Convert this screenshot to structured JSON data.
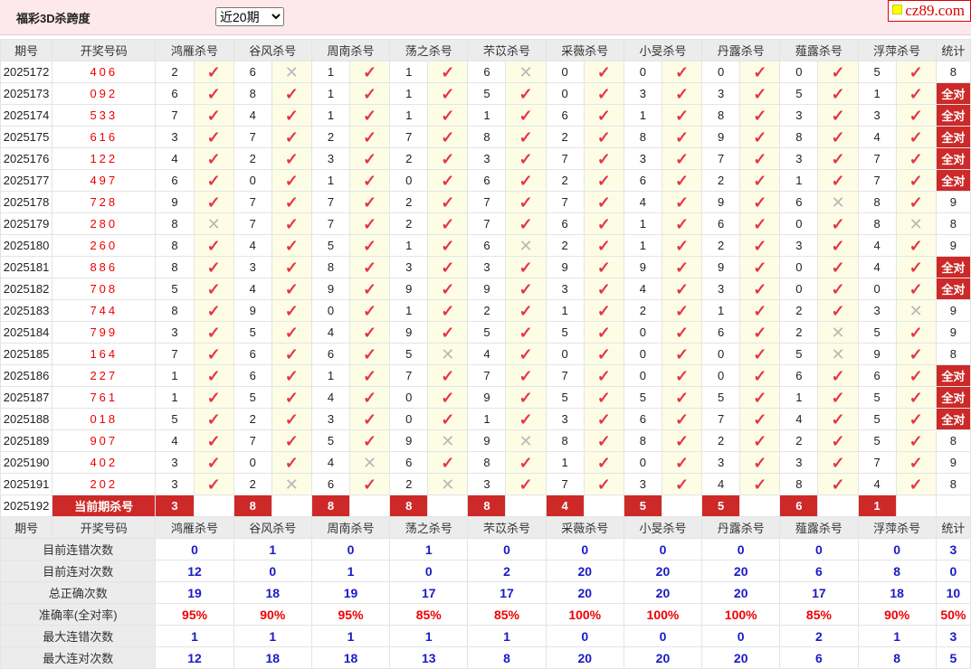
{
  "title": "福彩3D杀跨度",
  "period_select": {
    "selected": "近20期"
  },
  "logo": "cz89.com",
  "icons": {
    "ok": "✓",
    "no": "✕"
  },
  "headers": [
    "期号",
    "开奖号码",
    "鸿雁杀号",
    "谷风杀号",
    "周南杀号",
    "荡之杀号",
    "芣苡杀号",
    "采薇杀号",
    "小旻杀号",
    "丹露杀号",
    "薤露杀号",
    "浮萍杀号",
    "统计"
  ],
  "rows": [
    {
      "p": "2025172",
      "d": "406",
      "k": [
        [
          2,
          1
        ],
        [
          6,
          0
        ],
        [
          1,
          1
        ],
        [
          1,
          1
        ],
        [
          6,
          0
        ],
        [
          0,
          1
        ],
        [
          0,
          1
        ],
        [
          0,
          1
        ],
        [
          0,
          1
        ],
        [
          5,
          1
        ]
      ],
      "s": "8"
    },
    {
      "p": "2025173",
      "d": "092",
      "k": [
        [
          6,
          1
        ],
        [
          8,
          1
        ],
        [
          1,
          1
        ],
        [
          1,
          1
        ],
        [
          5,
          1
        ],
        [
          0,
          1
        ],
        [
          3,
          1
        ],
        [
          3,
          1
        ],
        [
          5,
          1
        ],
        [
          1,
          1
        ]
      ],
      "s": "全对"
    },
    {
      "p": "2025174",
      "d": "533",
      "k": [
        [
          7,
          1
        ],
        [
          4,
          1
        ],
        [
          1,
          1
        ],
        [
          1,
          1
        ],
        [
          1,
          1
        ],
        [
          6,
          1
        ],
        [
          1,
          1
        ],
        [
          8,
          1
        ],
        [
          3,
          1
        ],
        [
          3,
          1
        ]
      ],
      "s": "全对"
    },
    {
      "p": "2025175",
      "d": "616",
      "k": [
        [
          3,
          1
        ],
        [
          7,
          1
        ],
        [
          2,
          1
        ],
        [
          7,
          1
        ],
        [
          8,
          1
        ],
        [
          2,
          1
        ],
        [
          8,
          1
        ],
        [
          9,
          1
        ],
        [
          8,
          1
        ],
        [
          4,
          1
        ]
      ],
      "s": "全对"
    },
    {
      "p": "2025176",
      "d": "122",
      "k": [
        [
          4,
          1
        ],
        [
          2,
          1
        ],
        [
          3,
          1
        ],
        [
          2,
          1
        ],
        [
          3,
          1
        ],
        [
          7,
          1
        ],
        [
          3,
          1
        ],
        [
          7,
          1
        ],
        [
          3,
          1
        ],
        [
          7,
          1
        ]
      ],
      "s": "全对"
    },
    {
      "p": "2025177",
      "d": "497",
      "k": [
        [
          6,
          1
        ],
        [
          0,
          1
        ],
        [
          1,
          1
        ],
        [
          0,
          1
        ],
        [
          6,
          1
        ],
        [
          2,
          1
        ],
        [
          6,
          1
        ],
        [
          2,
          1
        ],
        [
          1,
          1
        ],
        [
          7,
          1
        ]
      ],
      "s": "全对"
    },
    {
      "p": "2025178",
      "d": "728",
      "k": [
        [
          9,
          1
        ],
        [
          7,
          1
        ],
        [
          7,
          1
        ],
        [
          2,
          1
        ],
        [
          7,
          1
        ],
        [
          7,
          1
        ],
        [
          4,
          1
        ],
        [
          9,
          1
        ],
        [
          6,
          0
        ],
        [
          8,
          1
        ]
      ],
      "s": "9"
    },
    {
      "p": "2025179",
      "d": "280",
      "k": [
        [
          8,
          0
        ],
        [
          7,
          1
        ],
        [
          7,
          1
        ],
        [
          2,
          1
        ],
        [
          7,
          1
        ],
        [
          6,
          1
        ],
        [
          1,
          1
        ],
        [
          6,
          1
        ],
        [
          0,
          1
        ],
        [
          8,
          0
        ]
      ],
      "s": "8"
    },
    {
      "p": "2025180",
      "d": "260",
      "k": [
        [
          8,
          1
        ],
        [
          4,
          1
        ],
        [
          5,
          1
        ],
        [
          1,
          1
        ],
        [
          6,
          0
        ],
        [
          2,
          1
        ],
        [
          1,
          1
        ],
        [
          2,
          1
        ],
        [
          3,
          1
        ],
        [
          4,
          1
        ]
      ],
      "s": "9"
    },
    {
      "p": "2025181",
      "d": "886",
      "k": [
        [
          8,
          1
        ],
        [
          3,
          1
        ],
        [
          8,
          1
        ],
        [
          3,
          1
        ],
        [
          3,
          1
        ],
        [
          9,
          1
        ],
        [
          9,
          1
        ],
        [
          9,
          1
        ],
        [
          0,
          1
        ],
        [
          4,
          1
        ]
      ],
      "s": "全对"
    },
    {
      "p": "2025182",
      "d": "708",
      "k": [
        [
          5,
          1
        ],
        [
          4,
          1
        ],
        [
          9,
          1
        ],
        [
          9,
          1
        ],
        [
          9,
          1
        ],
        [
          3,
          1
        ],
        [
          4,
          1
        ],
        [
          3,
          1
        ],
        [
          0,
          1
        ],
        [
          0,
          1
        ]
      ],
      "s": "全对"
    },
    {
      "p": "2025183",
      "d": "744",
      "k": [
        [
          8,
          1
        ],
        [
          9,
          1
        ],
        [
          0,
          1
        ],
        [
          1,
          1
        ],
        [
          2,
          1
        ],
        [
          1,
          1
        ],
        [
          2,
          1
        ],
        [
          1,
          1
        ],
        [
          2,
          1
        ],
        [
          3,
          0
        ]
      ],
      "s": "9"
    },
    {
      "p": "2025184",
      "d": "799",
      "k": [
        [
          3,
          1
        ],
        [
          5,
          1
        ],
        [
          4,
          1
        ],
        [
          9,
          1
        ],
        [
          5,
          1
        ],
        [
          5,
          1
        ],
        [
          0,
          1
        ],
        [
          6,
          1
        ],
        [
          2,
          0
        ],
        [
          5,
          1
        ]
      ],
      "s": "9"
    },
    {
      "p": "2025185",
      "d": "164",
      "k": [
        [
          7,
          1
        ],
        [
          6,
          1
        ],
        [
          6,
          1
        ],
        [
          5,
          0
        ],
        [
          4,
          1
        ],
        [
          0,
          1
        ],
        [
          0,
          1
        ],
        [
          0,
          1
        ],
        [
          5,
          0
        ],
        [
          9,
          1
        ]
      ],
      "s": "8"
    },
    {
      "p": "2025186",
      "d": "227",
      "k": [
        [
          1,
          1
        ],
        [
          6,
          1
        ],
        [
          1,
          1
        ],
        [
          7,
          1
        ],
        [
          7,
          1
        ],
        [
          7,
          1
        ],
        [
          0,
          1
        ],
        [
          0,
          1
        ],
        [
          6,
          1
        ],
        [
          6,
          1
        ]
      ],
      "s": "全对"
    },
    {
      "p": "2025187",
      "d": "761",
      "k": [
        [
          1,
          1
        ],
        [
          5,
          1
        ],
        [
          4,
          1
        ],
        [
          0,
          1
        ],
        [
          9,
          1
        ],
        [
          5,
          1
        ],
        [
          5,
          1
        ],
        [
          5,
          1
        ],
        [
          1,
          1
        ],
        [
          5,
          1
        ]
      ],
      "s": "全对"
    },
    {
      "p": "2025188",
      "d": "018",
      "k": [
        [
          5,
          1
        ],
        [
          2,
          1
        ],
        [
          3,
          1
        ],
        [
          0,
          1
        ],
        [
          1,
          1
        ],
        [
          3,
          1
        ],
        [
          6,
          1
        ],
        [
          7,
          1
        ],
        [
          4,
          1
        ],
        [
          5,
          1
        ]
      ],
      "s": "全对"
    },
    {
      "p": "2025189",
      "d": "907",
      "k": [
        [
          4,
          1
        ],
        [
          7,
          1
        ],
        [
          5,
          1
        ],
        [
          9,
          0
        ],
        [
          9,
          0
        ],
        [
          8,
          1
        ],
        [
          8,
          1
        ],
        [
          2,
          1
        ],
        [
          2,
          1
        ],
        [
          5,
          1
        ]
      ],
      "s": "8"
    },
    {
      "p": "2025190",
      "d": "402",
      "k": [
        [
          3,
          1
        ],
        [
          0,
          1
        ],
        [
          4,
          0
        ],
        [
          6,
          1
        ],
        [
          8,
          1
        ],
        [
          1,
          1
        ],
        [
          0,
          1
        ],
        [
          3,
          1
        ],
        [
          3,
          1
        ],
        [
          7,
          1
        ]
      ],
      "s": "9"
    },
    {
      "p": "2025191",
      "d": "202",
      "k": [
        [
          3,
          1
        ],
        [
          2,
          0
        ],
        [
          6,
          1
        ],
        [
          2,
          0
        ],
        [
          3,
          1
        ],
        [
          7,
          1
        ],
        [
          3,
          1
        ],
        [
          4,
          1
        ],
        [
          8,
          1
        ],
        [
          4,
          1
        ]
      ],
      "s": "8"
    }
  ],
  "current": {
    "p": "2025192",
    "label": "当前期杀号",
    "kills": [
      "3",
      "8",
      "8",
      "8",
      "8",
      "4",
      "5",
      "5",
      "6",
      "1"
    ]
  },
  "stats": [
    {
      "label": "目前连错次数",
      "values": [
        "0",
        "1",
        "0",
        "1",
        "0",
        "0",
        "0",
        "0",
        "0",
        "0",
        "3"
      ],
      "color": "blue"
    },
    {
      "label": "目前连对次数",
      "values": [
        "12",
        "0",
        "1",
        "0",
        "2",
        "20",
        "20",
        "20",
        "6",
        "8",
        "0"
      ],
      "color": "blue"
    },
    {
      "label": "总正确次数",
      "values": [
        "19",
        "18",
        "19",
        "17",
        "17",
        "20",
        "20",
        "20",
        "17",
        "18",
        "10"
      ],
      "color": "blue"
    },
    {
      "label": "准确率(全对率)",
      "values": [
        "95%",
        "90%",
        "95%",
        "85%",
        "85%",
        "100%",
        "100%",
        "100%",
        "85%",
        "90%",
        "50%"
      ],
      "color": "red"
    },
    {
      "label": "最大连错次数",
      "values": [
        "1",
        "1",
        "1",
        "1",
        "1",
        "0",
        "0",
        "0",
        "2",
        "1",
        "3"
      ],
      "color": "blue"
    },
    {
      "label": "最大连对次数",
      "values": [
        "12",
        "18",
        "18",
        "13",
        "8",
        "20",
        "20",
        "20",
        "6",
        "8",
        "5"
      ],
      "color": "blue"
    }
  ]
}
